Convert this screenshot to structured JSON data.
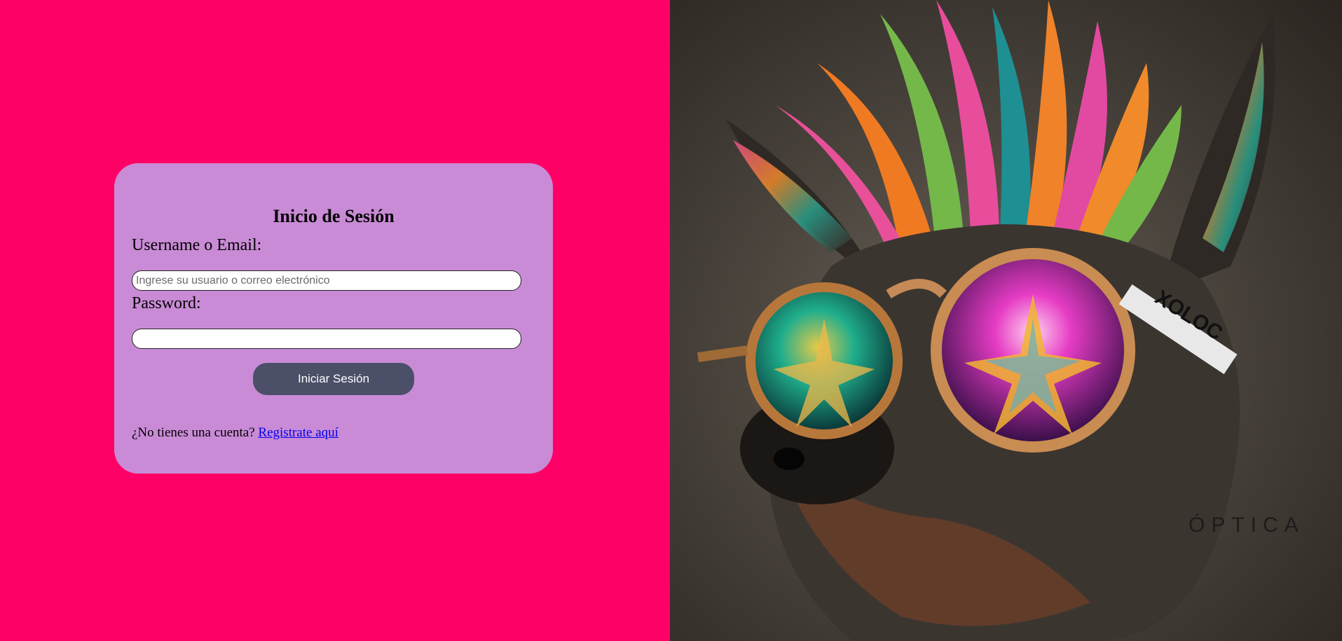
{
  "colors": {
    "page_background": "#ff0066",
    "card_background": "#c98bd6",
    "button_background": "#4b5068",
    "link_color": "#0000ee"
  },
  "login": {
    "title": "Inicio de Sesión",
    "username_label": "Username o Email:",
    "username_placeholder": "Ingrese su usuario o correo electrónico",
    "username_value": "",
    "password_label": "Password:",
    "password_value": "",
    "submit_label": "Iniciar Sesión",
    "register_prompt": "¿No tienes una cuenta?",
    "register_link": "Registrate aquí"
  },
  "hero": {
    "brand_text": "ÓPTICA",
    "glasses_text": "XOLOC",
    "icon": "xolo-dog-with-sunglasses-illustration"
  }
}
